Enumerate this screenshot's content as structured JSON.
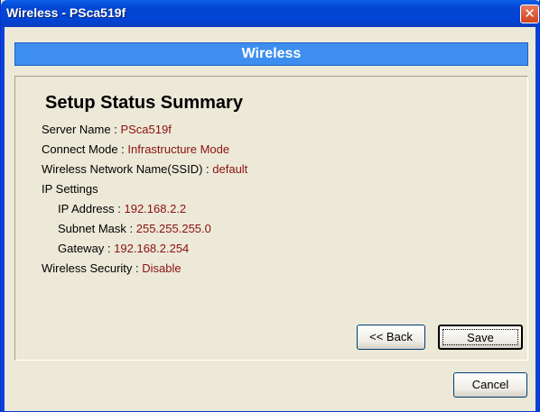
{
  "window": {
    "title": "Wireless - PSca519f",
    "close_label": "✕"
  },
  "banner": {
    "title": "Wireless"
  },
  "summary": {
    "heading": "Setup Status Summary",
    "server_name": {
      "label": "Server Name :",
      "value": "PSca519f"
    },
    "connect_mode": {
      "label": "Connect Mode :",
      "value": "Infrastructure Mode"
    },
    "ssid": {
      "label": "Wireless Network Name(SSID) :",
      "value": "default"
    },
    "ip_settings_label": "IP Settings",
    "ip_address": {
      "label": "IP Address :",
      "value": "192.168.2.2"
    },
    "subnet_mask": {
      "label": "Subnet Mask :",
      "value": "255.255.255.0"
    },
    "gateway": {
      "label": "Gateway :",
      "value": "192.168.2.254"
    },
    "security": {
      "label": "Wireless Security :",
      "value": "Disable"
    }
  },
  "buttons": {
    "back": "<< Back",
    "save": "Save",
    "cancel": "Cancel"
  },
  "colors": {
    "title_bar": "#0244d3",
    "banner": "#3d8ef0",
    "value_text": "#8b1010",
    "dialog_bg": "#ece9d8"
  }
}
